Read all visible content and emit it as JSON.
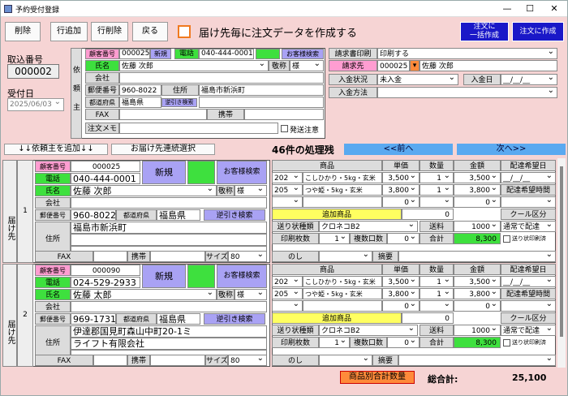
{
  "window": {
    "title": "予約受付登録"
  },
  "toolbar": {
    "delete": "削除",
    "add_row": "行追加",
    "del_row": "行削除",
    "back": "戻る",
    "checkbox_label": "届け先毎に注文データを作成する",
    "bulk_order": "注文に\n一括作成",
    "make_order": "注文に作成"
  },
  "left": {
    "receipt_label": "取込番号",
    "receipt_no": "000002",
    "date_label": "受付日",
    "date": "2025/06/03"
  },
  "client": {
    "side_label": "依頼主",
    "cust_no_label": "顧客番号",
    "cust_no": "000025",
    "new_label": "新規",
    "phone_label": "電話",
    "phone": "040-444-0001",
    "search_label": "お客様検索",
    "name_label": "氏名",
    "name": "佐藤 次郎",
    "honor_label": "敬称",
    "honor": "様",
    "company_label": "会社",
    "zip_label": "郵便番号",
    "zip": "960-8022",
    "addr_label": "住所",
    "addr": "福島市新浜町",
    "pref_label": "都道府県",
    "pref": "福島県",
    "reverse_label": "逆引き検索",
    "fax_label": "FAX",
    "mobile_label": "携帯",
    "memo_label": "注文メモ",
    "ship_note_label": "発送注意"
  },
  "billing": {
    "print_label": "請求書印刷",
    "print_value": "印刷する",
    "bill_to_label": "請求先",
    "bill_no": "000025",
    "bill_name": "佐藤 次郎",
    "pay_status_label": "入金状況",
    "pay_status": "未入金",
    "pay_date_label": "入金日",
    "pay_date": "__/__/__",
    "pay_method_label": "入金方法"
  },
  "bar": {
    "add_client": "↓↓依頼主を追加↓↓",
    "bulk_select": "お届け先連続選択",
    "remaining": "46件の処理残",
    "prev": "<<前へ",
    "next": "次へ>>"
  },
  "grid_headers": {
    "product": "商品",
    "unit_price": "単価",
    "qty": "数量",
    "amount": "金額",
    "delivery_date": "配達希望日",
    "delivery_time": "配達希望時間",
    "add_product": "追加商品",
    "cool": "クール区分",
    "ship_type": "送り状種類",
    "ship_fee": "送料",
    "print_count": "印刷枚数",
    "multi_count": "複数口数",
    "total": "合計",
    "slip_print_flag": "送り状印刷済",
    "noshi": "のし",
    "summary": "摘要",
    "size_label": "サイズ"
  },
  "dest_label": "届け先",
  "destinations": [
    {
      "index": "1",
      "cust_no": "000025",
      "phone": "040-444-0001",
      "name": "佐藤 次郎",
      "honor": "様",
      "zip": "960-8022",
      "pref": "福島県",
      "addr1": "福島市新浜町",
      "addr2": "",
      "size": "80",
      "items": [
        {
          "code": "202",
          "name": "こしひかり・5kg・玄米",
          "price": "3,500",
          "qty": "1",
          "amount": "3,500"
        },
        {
          "code": "205",
          "name": "つや姫・5kg・玄米",
          "price": "3,800",
          "qty": "1",
          "amount": "3,800"
        },
        {
          "code": "",
          "name": "",
          "price": "0",
          "qty": "",
          "amount": "0"
        }
      ],
      "add_amount": "0",
      "ship_type": "クロネコB2",
      "ship_fee": "1000",
      "cool": "通常で配達",
      "print_count": "1",
      "multi": "0",
      "total": "8,300"
    },
    {
      "index": "2",
      "cust_no": "000090",
      "phone": "024-529-2933",
      "name": "佐藤 太郎",
      "honor": "様",
      "zip": "969-1731",
      "pref": "福島県",
      "addr1": "伊達郡国見町森山中町20-1ミ",
      "addr2": "ライフト有限会社",
      "size": "80",
      "items": [
        {
          "code": "202",
          "name": "こしひかり・5kg・玄米",
          "price": "3,500",
          "qty": "1",
          "amount": "3,500"
        },
        {
          "code": "205",
          "name": "つや姫・5kg・玄米",
          "price": "3,800",
          "qty": "1",
          "amount": "3,800"
        },
        {
          "code": "",
          "name": "",
          "price": "0",
          "qty": "",
          "amount": "0"
        }
      ],
      "add_amount": "0",
      "ship_type": "クロネコB2",
      "ship_fee": "1000",
      "cool": "通常で配達",
      "print_count": "1",
      "multi": "0",
      "total": "8,300"
    }
  ],
  "footer": {
    "by_product": "商品別合計数量",
    "grand_label": "総合計:",
    "grand_total": "25,100"
  }
}
